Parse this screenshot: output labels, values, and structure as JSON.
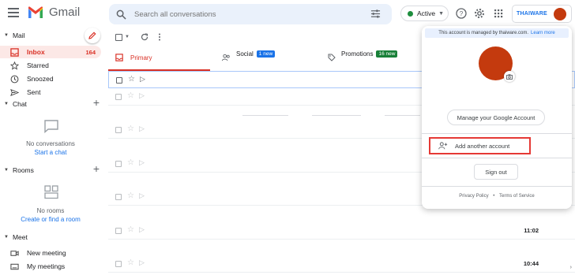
{
  "header": {
    "app_name": "Gmail",
    "search_placeholder": "Search all conversations",
    "status_label": "Active",
    "brand_text": "THAIWARE"
  },
  "sidebar": {
    "mail_header": "Mail",
    "items": [
      {
        "label": "Inbox",
        "count": "164",
        "icon": "inbox-icon",
        "active": true
      },
      {
        "label": "Starred",
        "icon": "star-icon"
      },
      {
        "label": "Snoozed",
        "icon": "clock-icon"
      },
      {
        "label": "Sent",
        "icon": "send-icon"
      }
    ],
    "chat_header": "Chat",
    "chat_empty": "No conversations",
    "chat_link": "Start a chat",
    "rooms_header": "Rooms",
    "rooms_empty": "No rooms",
    "rooms_link": "Create or find a room",
    "meet_header": "Meet",
    "meet_items": [
      {
        "label": "New meeting",
        "icon": "video-icon"
      },
      {
        "label": "My meetings",
        "icon": "keyboard-icon"
      }
    ]
  },
  "tabs": [
    {
      "label": "Primary"
    },
    {
      "label": "Social",
      "badge": "1 new",
      "badge_color": "#1a73e8"
    },
    {
      "label": "Promotions",
      "badge": "16 new",
      "badge_color": "#188038"
    }
  ],
  "rows": [
    {
      "time": ""
    },
    {
      "time": ""
    },
    {
      "time": ""
    },
    {
      "time": ""
    },
    {
      "time": ""
    },
    {
      "time": ""
    },
    {
      "time": "11:02"
    },
    {
      "time": ""
    },
    {
      "time": "10:44"
    }
  ],
  "popup": {
    "managed_text": "This account is managed by thaiware.com.",
    "learn_more": "Learn more",
    "manage_button": "Manage your Google Account",
    "add_account": "Add another account",
    "sign_out": "Sign out",
    "privacy": "Privacy Policy",
    "separator": "•",
    "terms": "Terms of Service"
  },
  "colors": {
    "accent_red": "#d93025",
    "avatar": "#c43a0e",
    "highlight_box": "#e53935"
  }
}
